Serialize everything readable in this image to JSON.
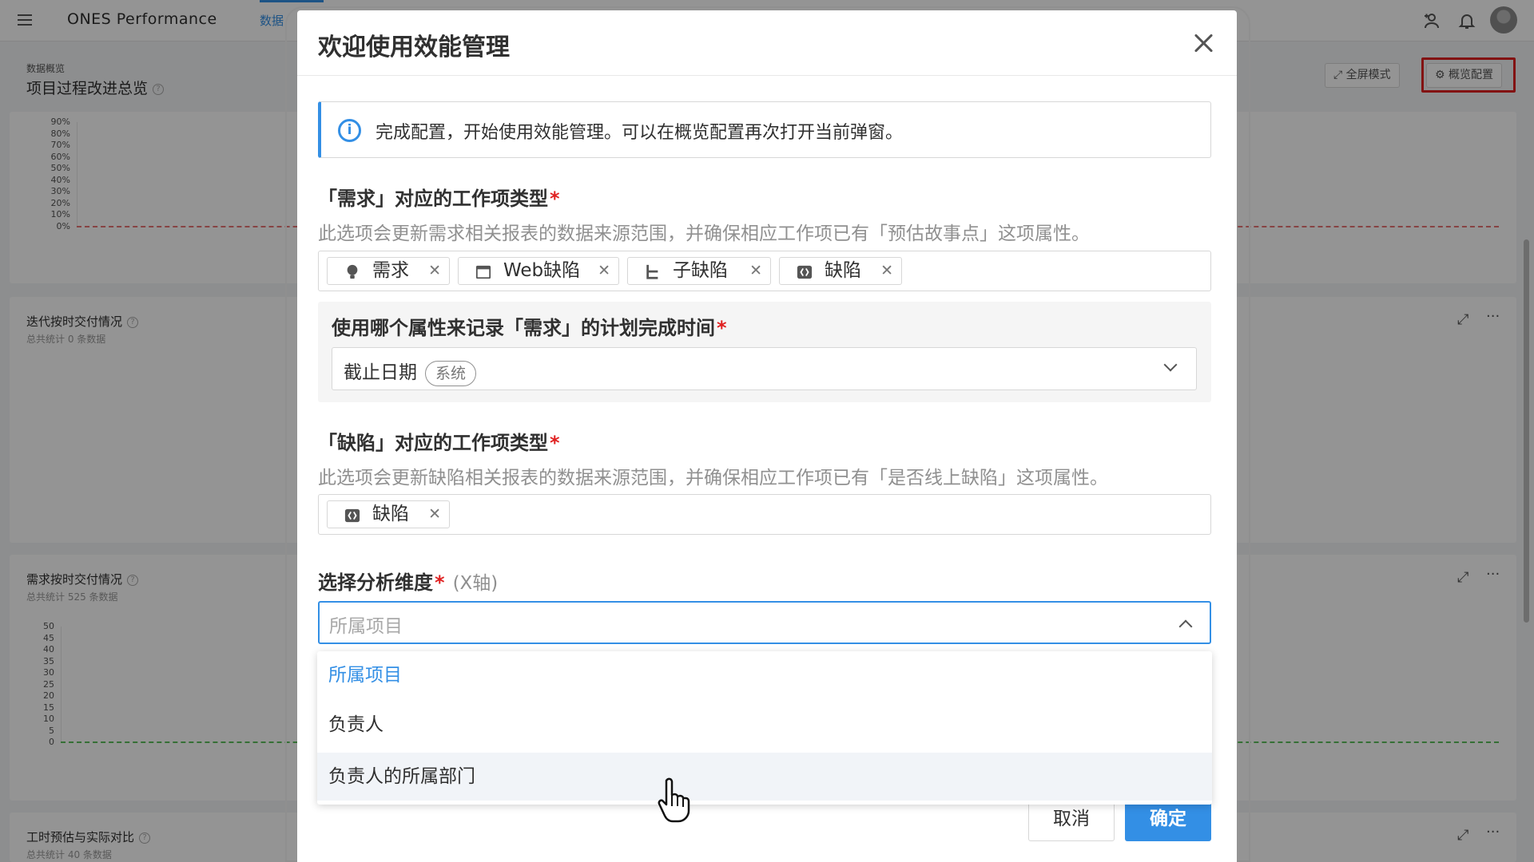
{
  "app": {
    "title": "ONES Performance",
    "nav_tab": "数据"
  },
  "page": {
    "breadcrumb": "数据概览",
    "title": "项目过程改进总览",
    "fullscreen_label": "全屏模式",
    "config_label": "概览配置"
  },
  "cards": [
    {
      "title": "迭代按时交付情况",
      "subtitle": "总共统计 0 条数据"
    },
    {
      "title": "需求按时交付情况",
      "subtitle": "总共统计 525 条数据"
    },
    {
      "title": "工时预估与实际对比",
      "subtitle": "总共统计 40 条数据"
    }
  ],
  "chart_pct_ticks": [
    "90%",
    "80%",
    "70%",
    "60%",
    "50%",
    "40%",
    "30%",
    "20%",
    "10%",
    "0%"
  ],
  "chart_num_ticks": [
    "50",
    "45",
    "40",
    "35",
    "30",
    "25",
    "20",
    "15",
    "10",
    "5",
    "0"
  ],
  "modal": {
    "title": "欢迎使用效能管理",
    "info": "完成配置，开始使用效能管理。可以在概览配置再次打开当前弹窗。",
    "req_field": {
      "label": "「需求」对应的工作项类型",
      "hint": "此选项会更新需求相关报表的数据来源范围，并确保相应工作项已有「预估故事点」这项属性。",
      "tags": [
        "需求",
        "Web缺陷",
        "子缺陷",
        "缺陷"
      ]
    },
    "plan_field": {
      "label": "使用哪个属性来记录「需求」的计划完成时间",
      "value": "截止日期",
      "badge": "系统"
    },
    "bug_field": {
      "label": "「缺陷」对应的工作项类型",
      "hint": "此选项会更新缺陷相关报表的数据来源范围，并确保相应工作项已有「是否线上缺陷」这项属性。",
      "tags": [
        "缺陷"
      ]
    },
    "dim_field": {
      "label": "选择分析维度",
      "axis": "(X轴)",
      "placeholder": "所属项目",
      "options": [
        "所属项目",
        "负责人",
        "负责人的所属部门"
      ]
    },
    "cancel": "取消",
    "ok": "确定"
  },
  "colors": {
    "accent": "#338fe5",
    "required": "#e02020",
    "highlight": "#e02020"
  },
  "icons": [
    "menu-icon",
    "add-member-icon",
    "bell-icon",
    "expand-icon",
    "gear-icon",
    "more-icon",
    "info-icon",
    "close-icon",
    "bulb-icon",
    "window-icon",
    "subtask-icon",
    "bug-icon",
    "chevron-down-icon",
    "chevron-up-icon",
    "hand-cursor-icon"
  ]
}
